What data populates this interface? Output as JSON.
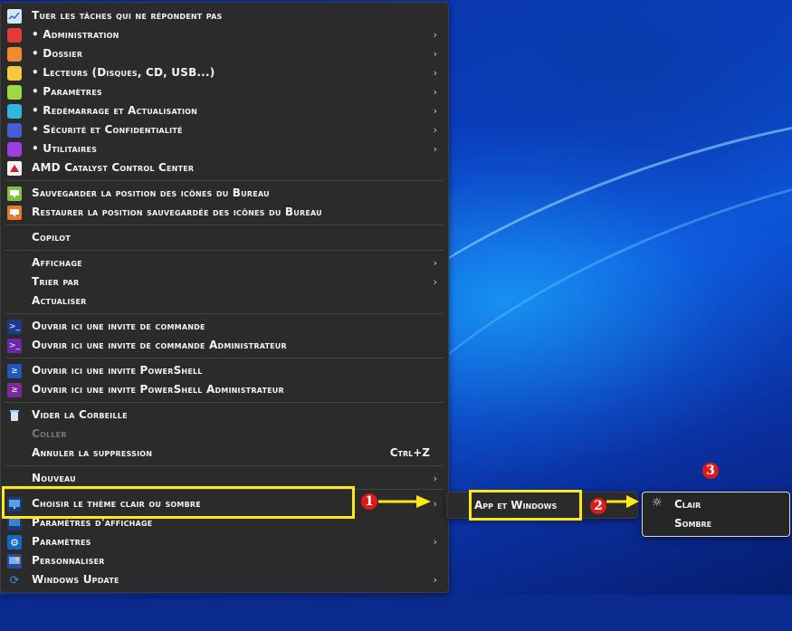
{
  "menu": {
    "items": [
      {
        "label": "Tuer les tâches qui ne répondent pas",
        "icon": "task-manager-icon",
        "submenu": false
      },
      {
        "label": "• Administration",
        "icon": "red-swatch-icon",
        "color": "#e53935",
        "submenu": true
      },
      {
        "label": "• Dossier",
        "icon": "orange-swatch-icon",
        "color": "#f08a30",
        "submenu": true
      },
      {
        "label": "• Lecteurs (Disques, CD, USB...)",
        "icon": "yellow-swatch-icon",
        "color": "#f5c842",
        "submenu": true
      },
      {
        "label": "• Paramètres",
        "icon": "lime-swatch-icon",
        "color": "#9ed94a",
        "submenu": true
      },
      {
        "label": "• Redémarrage et Actualisation",
        "icon": "cyan-swatch-icon",
        "color": "#2fb7e0",
        "submenu": true
      },
      {
        "label": "• Sécurité et Confidentialité",
        "icon": "blue-swatch-icon",
        "color": "#4a5bd8",
        "submenu": true
      },
      {
        "label": "• Utilitaires",
        "icon": "purple-swatch-icon",
        "color": "#9b3fe0",
        "submenu": true
      },
      {
        "label": "AMD Catalyst Control Center",
        "icon": "amd-catalyst-icon",
        "submenu": false
      },
      {
        "label": "Sauvegarder la position des icônes du Bureau",
        "icon": "save-desktop-icon",
        "submenu": false
      },
      {
        "label": "Restaurer la position sauvegardée des icônes du Bureau",
        "icon": "restore-desktop-icon",
        "submenu": false
      },
      {
        "label": "Copilot",
        "icon": "",
        "submenu": false
      },
      {
        "label": "Affichage",
        "icon": "",
        "submenu": true
      },
      {
        "label": "Trier par",
        "icon": "",
        "submenu": true
      },
      {
        "label": "Actualiser",
        "icon": "",
        "submenu": false
      },
      {
        "label": "Ouvrir ici une invite de commande",
        "icon": "cmd-icon",
        "submenu": false
      },
      {
        "label": "Ouvrir ici une invite de commande Administrateur",
        "icon": "cmd-admin-icon",
        "submenu": false
      },
      {
        "label": "Ouvrir ici une invite PowerShell",
        "icon": "powershell-icon",
        "submenu": false
      },
      {
        "label": "Ouvrir ici une invite PowerShell Administrateur",
        "icon": "powershell-admin-icon",
        "submenu": false
      },
      {
        "label": "Vider la Corbeille",
        "icon": "recycle-bin-icon",
        "submenu": false
      },
      {
        "label": "Coller",
        "icon": "",
        "submenu": false,
        "disabled": true
      },
      {
        "label": "Annuler la suppression",
        "icon": "",
        "submenu": false,
        "shortcut": "Ctrl+Z"
      },
      {
        "label": "Nouveau",
        "icon": "",
        "submenu": true
      },
      {
        "label": "Choisir le thème clair ou sombre",
        "icon": "theme-monitor-icon",
        "submenu": true
      },
      {
        "label": "Paramètres d'affichage",
        "icon": "display-settings-icon",
        "submenu": false
      },
      {
        "label": "Paramètres",
        "icon": "gear-icon",
        "submenu": true
      },
      {
        "label": "Personnaliser",
        "icon": "personalize-icon",
        "submenu": false
      },
      {
        "label": "Windows Update",
        "icon": "windows-update-icon",
        "submenu": true
      }
    ]
  },
  "submenu1": {
    "label": "App et Windows"
  },
  "submenu2": {
    "items": [
      {
        "label": "Clair",
        "icon": "sun-icon"
      },
      {
        "label": "Sombre",
        "icon": ""
      }
    ]
  },
  "annotations": {
    "step1": "1",
    "step2": "2",
    "step3": "3",
    "highlight_color": "#ffe81a",
    "badge_color": "#e01a1a"
  }
}
